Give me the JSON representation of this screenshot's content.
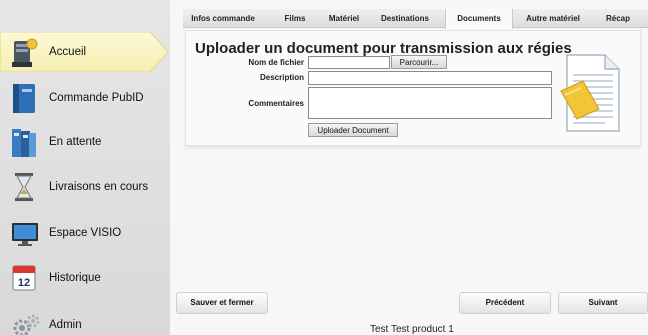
{
  "sidebar": {
    "items": [
      {
        "label": "Accueil",
        "active": true
      },
      {
        "label": "Commande PubID"
      },
      {
        "label": "En attente"
      },
      {
        "label": "Livraisons en cours"
      },
      {
        "label": "Espace VISIO"
      },
      {
        "label": "Historique"
      },
      {
        "label": "Admin"
      }
    ],
    "calendar_day": "12"
  },
  "tabs": [
    {
      "label": "Infos commande"
    },
    {
      "label": "Films"
    },
    {
      "label": "Matériel"
    },
    {
      "label": "Destinations"
    },
    {
      "label": "Documents",
      "active": true
    },
    {
      "label": "Autre matériel"
    },
    {
      "label": "Récap"
    }
  ],
  "form": {
    "title": "Uploader un document pour transmission aux régies",
    "file_label": "Nom de fichier",
    "file_value": "",
    "browse_label": "Parcourir...",
    "description_label": "Description",
    "description_value": "",
    "comments_label": "Commentaires",
    "comments_value": "",
    "upload_label": "Uploader Document"
  },
  "footer": {
    "save_close_label": "Sauver et fermer",
    "previous_label": "Précédent",
    "next_label": "Suivant",
    "status_text": "Test Test product 1"
  },
  "colors": {
    "active_nav": "#fbf5c4",
    "accent_yellow": "#f0c537"
  }
}
